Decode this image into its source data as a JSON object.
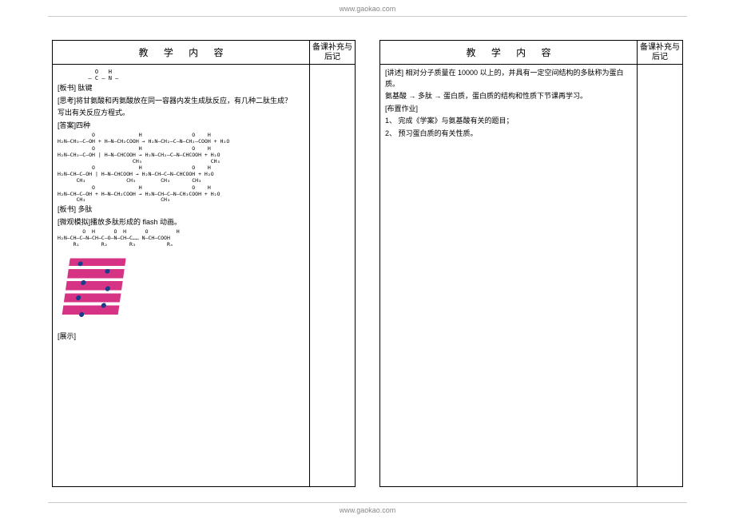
{
  "url": "www.gaokao.com",
  "header": {
    "content_label": "教    学    内        容",
    "note_label": "备课补充与后记"
  },
  "left": {
    "peptide_struct_line1": "    O   H",
    "peptide_struct_line2": "    ‖   |",
    "peptide_struct_line3": "  — C — N —",
    "t1": "[板书]  肽键",
    "t2": "[思考]将甘氨酸和丙氨酸放在同一容器内发生成肽反应，有几种二肽生成？",
    "t3": "写出有关反应方程式。",
    "t4": "[答案]四种",
    "eq1a": "           O              H                O    H",
    "eq1b": "           ‖              |                ‖    |",
    "eq1c": "H₂N—CH₂—C—OH + H—N—CH₂COOH → H₂N—CH₂—C—N—CH₂—COOH + H₂O",
    "eq2a": "           O              H                O    H",
    "eq2b": "           ‖              |                ‖    |",
    "eq2c": "H₂N—CH₂—C—OH | H—N—CHCOOH → H₂N—CH₂—C—N—CHCOOH + H₂O",
    "eq2d": "                        |                        |",
    "eq2e": "                        CH₃                      CH₃",
    "eq3a": "           O              H                O    H",
    "eq3b": "           ‖              |                ‖    |",
    "eq3c": "H₂N—CH—C—OH | H—N—CHCOOH → H₂N—CH—C—N—CHCOOH + H₂O",
    "eq3d": "      |               |          |         |",
    "eq3e": "      CH₃             CH₃        CH₃       CH₃",
    "eq4a": "           O              H                O    H",
    "eq4b": "           ‖              |                ‖    |",
    "eq4c": "H₂N—CH—C—OH + H—N—CH₂COOH → H₂N—CH—C—N—CH₂COOH + H₂O",
    "eq4d": "      |                          |",
    "eq4e": "      CH₃                        CH₃",
    "t5": "[板书]  多肽",
    "t6": "[微观模拟]播放多肽形成的 flash 动画。",
    "poly1": "        O  H      O  H      O         H",
    "poly2": "        ‖  |      ‖  |      ‖         |",
    "poly3": "H₂N—CH—C—N—CH—C—O—N—CH—C…… N—CH—COOH",
    "poly4": "     |        |        |           |",
    "poly5": "     R₁       R₂       R₃          Rₙ",
    "t7": "[展示]"
  },
  "right": {
    "t1": "[讲述]  相对分子质量在 10000 以上的，并具有一定空间结构的多肽称为蛋白质。",
    "t2": "氨基酸 → 多肽 → 蛋白质，蛋白质的结构和性质下节课再学习。",
    "t3": "[布置作业]",
    "t4": "1、 完成《学案》与氨基酸有关的题目；",
    "t5": "2、 预习蛋白质的有关性质。"
  }
}
